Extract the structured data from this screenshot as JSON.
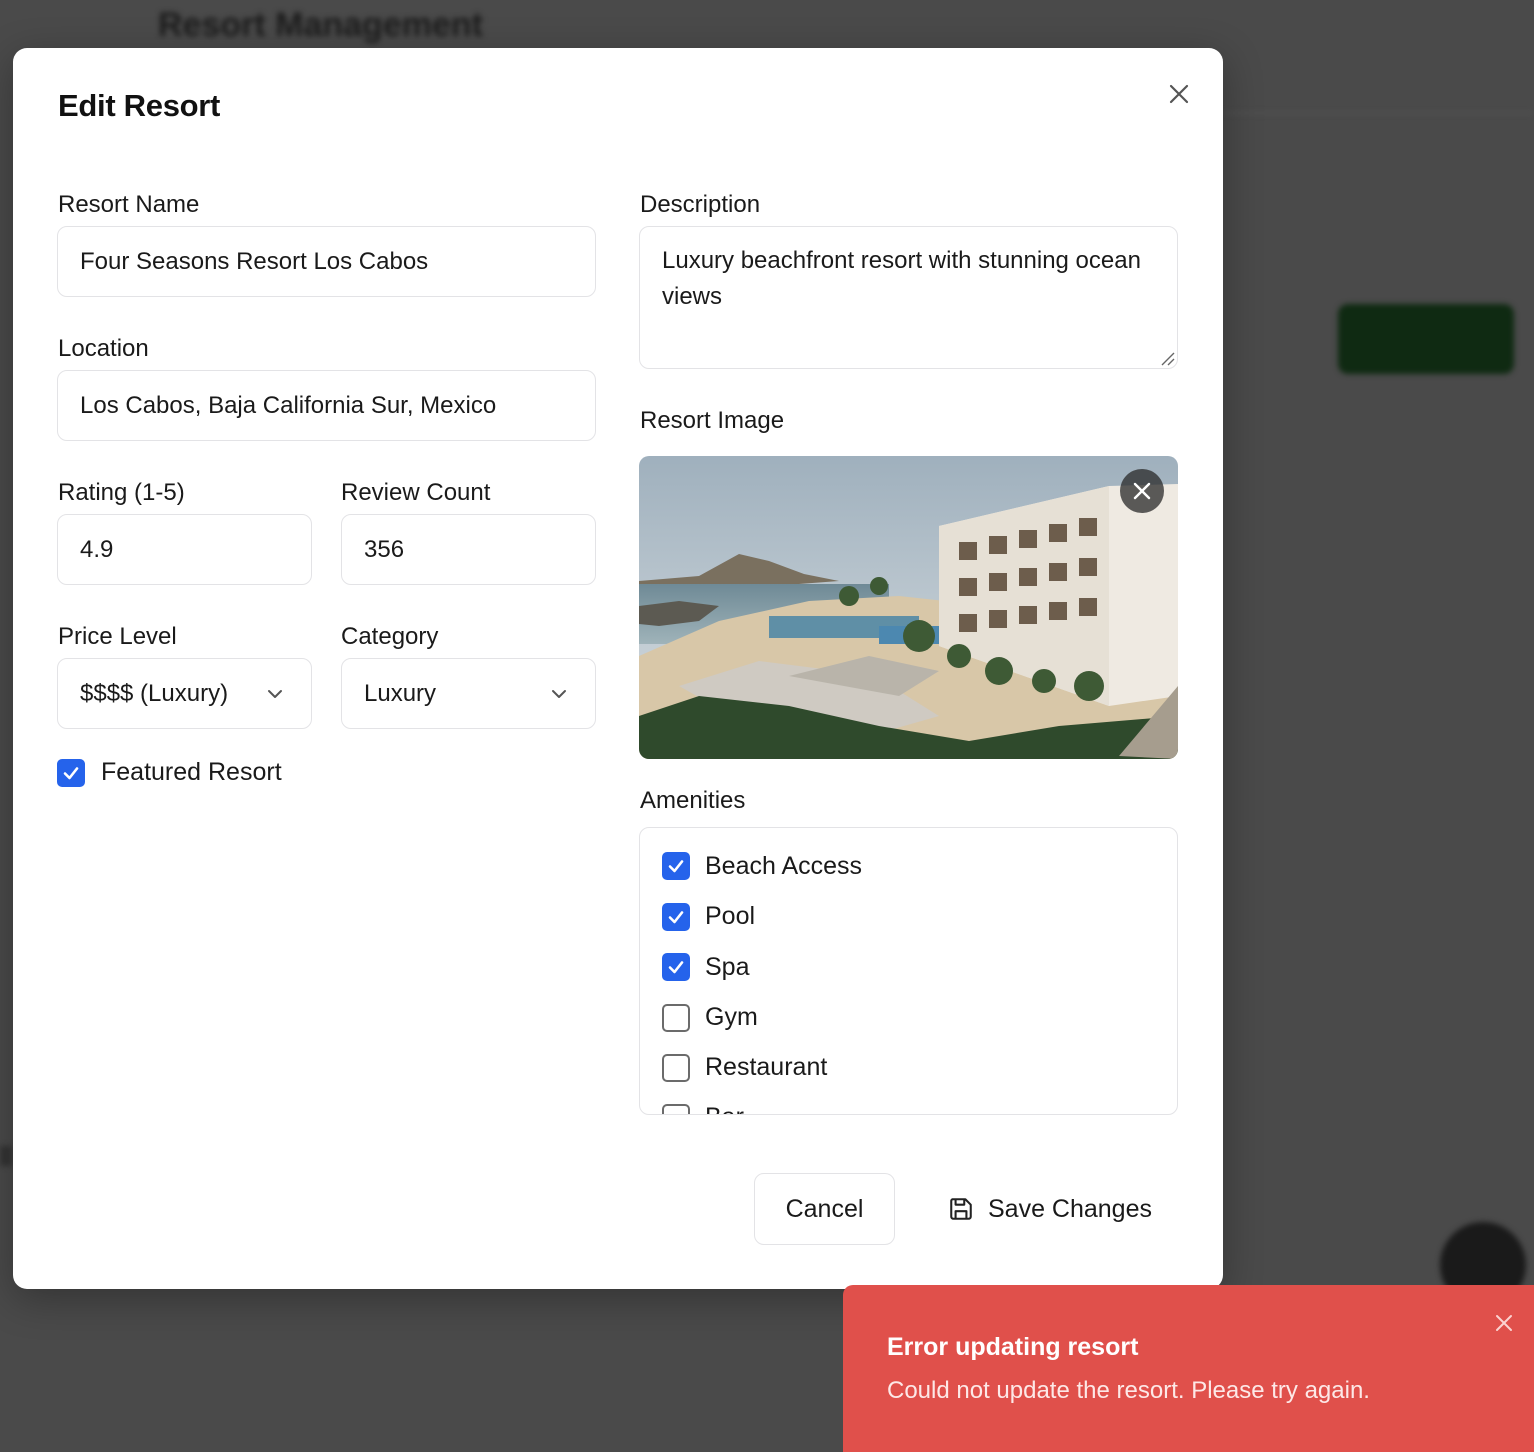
{
  "background": {
    "page_title": "Resort Management"
  },
  "modal": {
    "title": "Edit Resort",
    "fields": {
      "name": {
        "label": "Resort Name",
        "value": "Four Seasons Resort Los Cabos"
      },
      "location": {
        "label": "Location",
        "value": "Los Cabos, Baja California Sur, Mexico"
      },
      "rating": {
        "label": "Rating (1-5)",
        "value": "4.9"
      },
      "review_count": {
        "label": "Review Count",
        "value": "356"
      },
      "price_level": {
        "label": "Price Level",
        "value": "$$$$ (Luxury)"
      },
      "category": {
        "label": "Category",
        "value": "Luxury"
      },
      "featured": {
        "label": "Featured Resort",
        "checked": true
      },
      "description": {
        "label": "Description",
        "value": "Luxury beachfront resort with stunning ocean views"
      },
      "image": {
        "label": "Resort Image"
      }
    },
    "amenities": {
      "label": "Amenities",
      "items": [
        {
          "label": "Beach Access",
          "checked": true
        },
        {
          "label": "Pool",
          "checked": true
        },
        {
          "label": "Spa",
          "checked": true
        },
        {
          "label": "Gym",
          "checked": false
        },
        {
          "label": "Restaurant",
          "checked": false
        },
        {
          "label": "Bar",
          "checked": false
        }
      ]
    },
    "buttons": {
      "cancel": "Cancel",
      "save": "Save Changes"
    }
  },
  "toast": {
    "title": "Error updating resort",
    "message": "Could not update the resort. Please try again."
  },
  "colors": {
    "accent": "#2563eb",
    "error": "#e0504b",
    "overlay": "#4a4a4a"
  }
}
